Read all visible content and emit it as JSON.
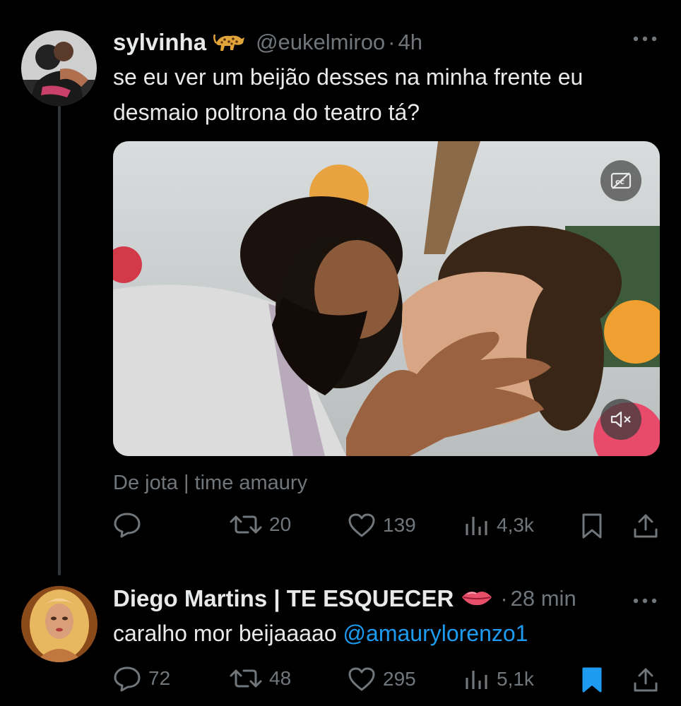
{
  "tweet1": {
    "display_name": "sylvinha",
    "name_emoji": "leopard-emoji",
    "handle": "@eukelmiroo",
    "separator": "·",
    "time": "4h",
    "more_icon": "more-icon",
    "text_line1": "se eu ver um beijão desses na minha frente eu",
    "text_line2": "desmaio poltrona do teatro tá?",
    "media": {
      "captions_icon": "closed-captions-off-icon",
      "mute_icon": "speaker-muted-icon"
    },
    "attribution": "De jota | time amaury",
    "actions": {
      "reply_count": "",
      "retweet_count": "20",
      "like_count": "139",
      "views_count": "4,3k"
    }
  },
  "tweet2": {
    "display_name": "Diego Martins | TE ESQUECER",
    "name_emoji": "lips-emoji",
    "separator": "·",
    "time": "28 min",
    "text": "caralho mor beijaaaao",
    "mention": "@amaurylorenzo1",
    "actions": {
      "reply_count": "72",
      "retweet_count": "48",
      "like_count": "295",
      "views_count": "5,1k",
      "bookmarked": true
    }
  },
  "colors": {
    "background": "#000000",
    "text": "#e7e9ea",
    "muted": "#71767b",
    "accent": "#1d9bf0"
  }
}
